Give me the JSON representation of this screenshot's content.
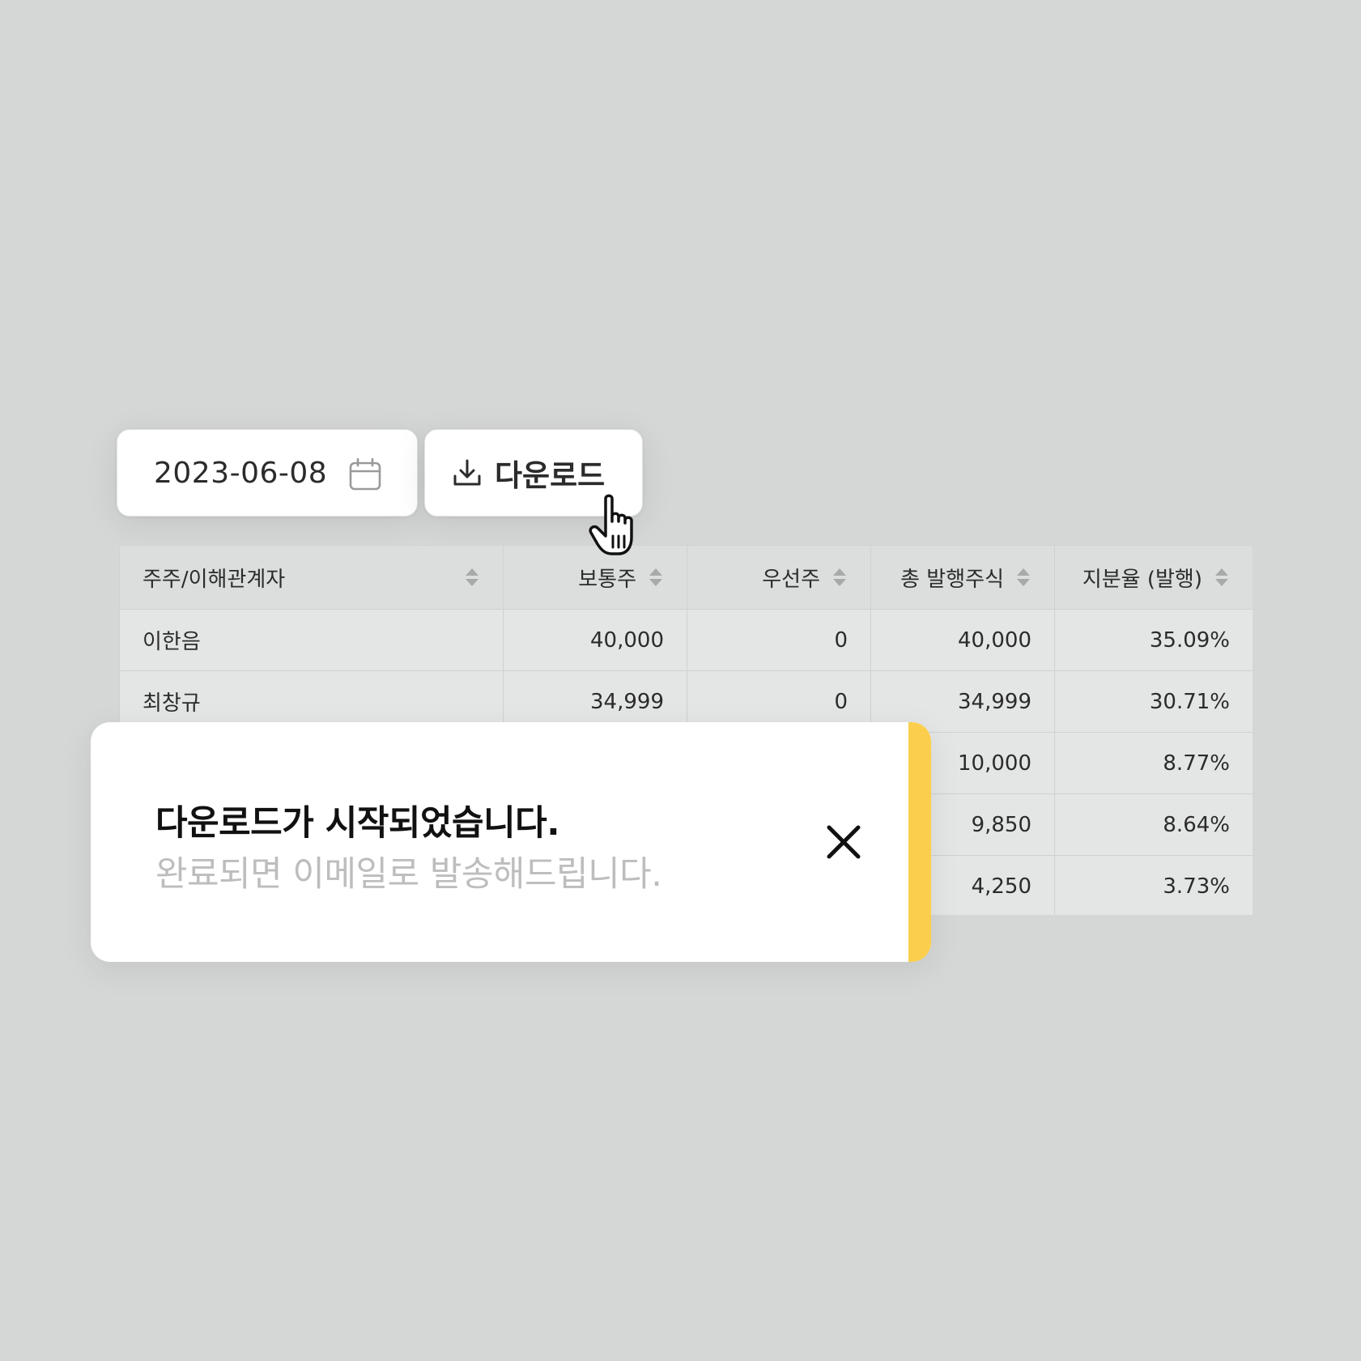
{
  "date_picker": {
    "value": "2023-06-08",
    "icon": "calendar-icon"
  },
  "download_button": {
    "label": "다운로드",
    "icon": "download-icon"
  },
  "table": {
    "headers": [
      "주주/이해관계자",
      "보통주",
      "우선주",
      "총 발행주식",
      "지분율 (발행)"
    ],
    "rows": [
      [
        "이한음",
        "40,000",
        "0",
        "40,000",
        "35.09%"
      ],
      [
        "최창규",
        "34,999",
        "0",
        "34,999",
        "30.71%"
      ],
      [
        "",
        "",
        "",
        "10,000",
        "8.77%"
      ],
      [
        "",
        "",
        "",
        "9,850",
        "8.64%"
      ],
      [
        "",
        "",
        "",
        "4,250",
        "3.73%"
      ]
    ]
  },
  "toast": {
    "title": "다운로드가 시작되었습니다.",
    "message": "완료되면 이메일로 발송해드립니다.",
    "accent_color": "#fbcf4d",
    "close_icon": "close-icon"
  }
}
